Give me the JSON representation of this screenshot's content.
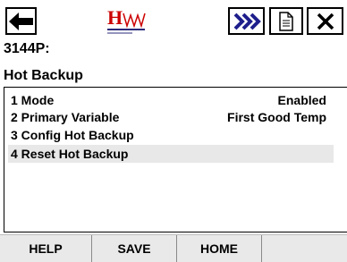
{
  "toolbar": {
    "back_icon": "left-arrow-icon",
    "logo_letters": "HW",
    "logo_color": "#cc0000",
    "fast_forward_icon": "double-chevron-right-icon",
    "fast_forward_color": "#1e1e8c",
    "document_icon": "document-icon",
    "close_icon": "close-icon"
  },
  "header": {
    "device": "3144P:",
    "title": "Hot Backup"
  },
  "menu": {
    "items": [
      {
        "label": "1 Mode",
        "value": "Enabled"
      },
      {
        "label": "2 Primary Variable",
        "value": "First Good Temp"
      },
      {
        "label": "3 Config Hot Backup",
        "value": ""
      },
      {
        "label": "4 Reset Hot Backup",
        "value": ""
      }
    ],
    "selected_index": 3
  },
  "footer": {
    "help_label": "HELP",
    "save_label": "SAVE",
    "home_label": "HOME"
  }
}
